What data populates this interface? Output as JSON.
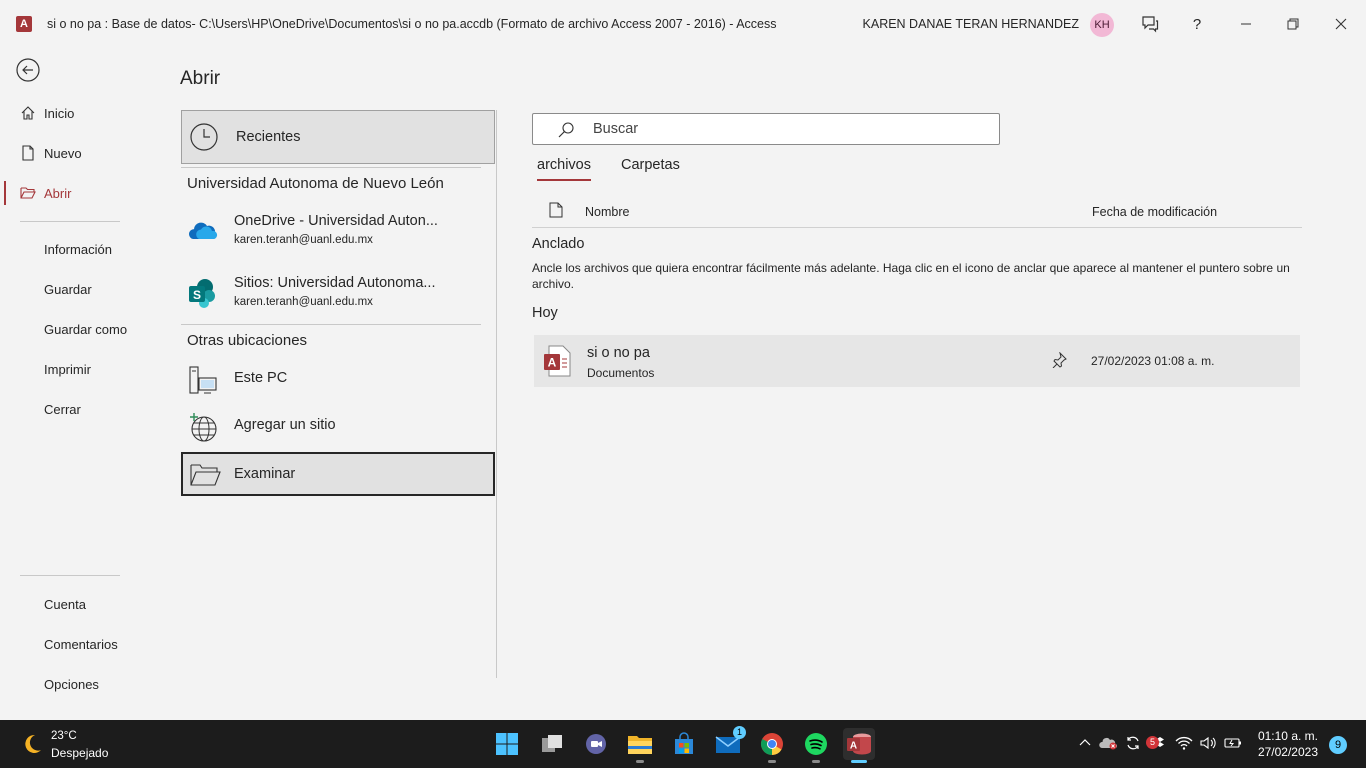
{
  "titlebar": {
    "app_icon_letter": "A",
    "title": "si o no pa : Base de datos- C:\\Users\\HP\\OneDrive\\Documentos\\si o no pa.accdb (Formato de archivo Access 2007 - 2016)  -  Access",
    "user_name": "KAREN DANAE TERAN HERNANDEZ",
    "avatar_initials": "KH",
    "help_label": "?"
  },
  "nav": {
    "items": [
      {
        "label": "Inicio",
        "icon": "home-icon"
      },
      {
        "label": "Nuevo",
        "icon": "new-document-icon"
      },
      {
        "label": "Abrir",
        "icon": "open-folder-icon"
      },
      {
        "label": "Información"
      },
      {
        "label": "Guardar"
      },
      {
        "label": "Guardar como"
      },
      {
        "label": "Imprimir"
      },
      {
        "label": "Cerrar"
      },
      {
        "label": "Cuenta"
      },
      {
        "label": "Comentarios"
      },
      {
        "label": "Opciones"
      }
    ]
  },
  "main": {
    "title": "Abrir",
    "locations": {
      "recent": "Recientes",
      "org_heading": "Universidad Autonoma de Nuevo León",
      "onedrive": {
        "title": "OneDrive - Universidad Auton...",
        "email": "karen.teranh@uanl.edu.mx"
      },
      "sites": {
        "title": "Sitios: Universidad Autonoma...",
        "email": "karen.teranh@uanl.edu.mx",
        "icon_letter": "S"
      },
      "other_heading": "Otras ubicaciones",
      "this_pc": "Este PC",
      "add_site": "Agregar un sitio",
      "browse": "Examinar"
    },
    "files": {
      "search_placeholder": "Buscar",
      "tabs": [
        "archivos",
        "Carpetas"
      ],
      "col_name": "Nombre",
      "col_date": "Fecha de modificación",
      "pinned_heading": "Anclado",
      "pinned_desc": "Ancle los archivos que quiera encontrar fácilmente más adelante. Haga clic en el icono de anclar que aparece al mantener el puntero sobre un archivo.",
      "today_heading": "Hoy",
      "rows": [
        {
          "name": "si o no pa",
          "location": "Documentos",
          "date": "27/02/2023 01:08 a. m.",
          "icon_letter": "A"
        }
      ]
    }
  },
  "taskbar": {
    "weather_temp": "23°C",
    "weather_cond": "Despejado",
    "mail_badge": "1",
    "tray_badge": "5",
    "time": "01:10 a. m.",
    "date": "27/02/2023",
    "notifications": "9"
  },
  "colors": {
    "accent": "#a4373a",
    "taskbar": "#1c1c1c",
    "background": "#f3f3f3"
  }
}
